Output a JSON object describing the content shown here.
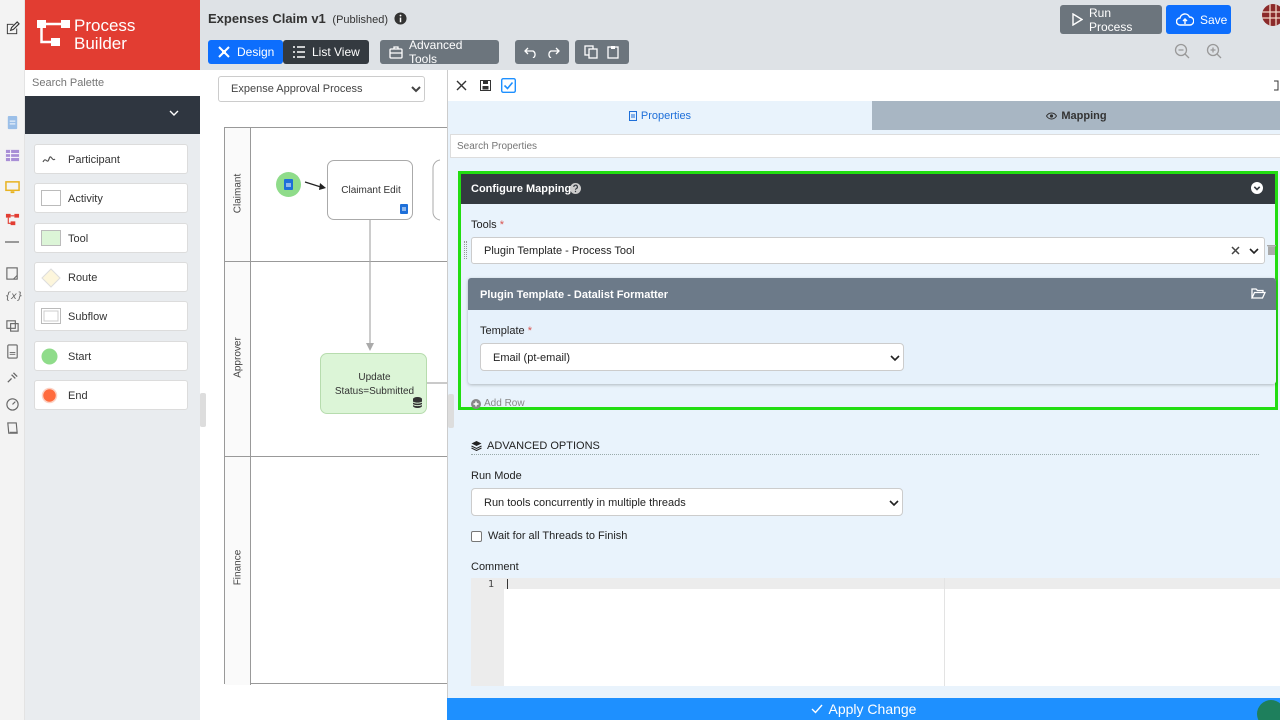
{
  "app": {
    "brand_line1": "Process",
    "brand_line2": "Builder",
    "title": "Expenses Claim v1",
    "status": "(Published)"
  },
  "toolbar": {
    "design": "Design",
    "list_view": "List View",
    "advanced_tools": "Advanced Tools",
    "run_process": "Run Process",
    "save": "Save"
  },
  "palette": {
    "search_placeholder": "Search Palette",
    "items": [
      {
        "label": "Participant"
      },
      {
        "label": "Activity"
      },
      {
        "label": "Tool"
      },
      {
        "label": "Route"
      },
      {
        "label": "Subflow"
      },
      {
        "label": "Start"
      },
      {
        "label": "End"
      }
    ]
  },
  "canvas": {
    "process_select": "Expense Approval Process",
    "lanes": [
      "Claimant",
      "Approver",
      "Finance"
    ],
    "nodes": {
      "claimant_edit": "Claimant Edit",
      "update_status_line1": "Update",
      "update_status_line2": "Status=Submitted"
    }
  },
  "panel": {
    "tab_properties": "Properties",
    "tab_mapping": "Mapping",
    "search_placeholder": "Search Properties",
    "configure_mapping": "Configure Mapping",
    "tools_label": "Tools",
    "required_mark": "*",
    "tools_value": "Plugin Template - Process Tool",
    "plugin_header": "Plugin Template - Datalist Formatter",
    "template_label": "Template",
    "template_value": "Email (pt-email)",
    "add_row": "Add Row",
    "advanced_options": "ADVANCED OPTIONS",
    "run_mode_label": "Run Mode",
    "run_mode_value": "Run tools concurrently in multiple threads",
    "wait_threads": "Wait for all Threads to Finish",
    "comment_label": "Comment",
    "line_number": "1",
    "apply_change": "Apply Change"
  },
  "colors": {
    "brand": "#e23d32",
    "primary": "#0d6efd",
    "highlight": "#22dd11",
    "dark_header": "#343a40"
  }
}
